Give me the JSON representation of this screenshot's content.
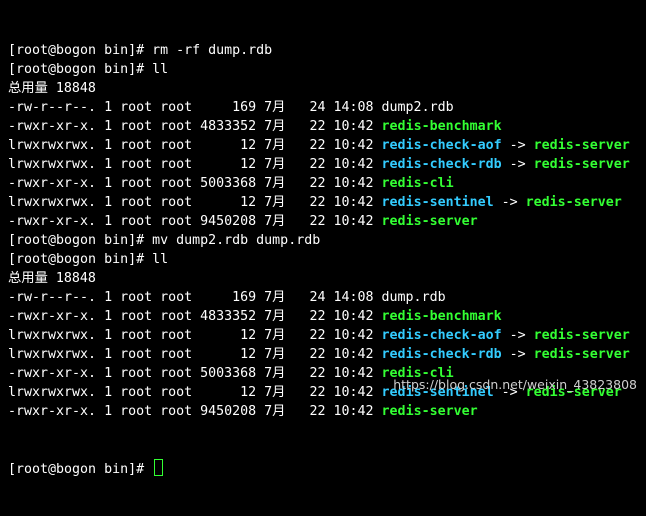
{
  "colors": {
    "background": "#000000",
    "text": "#ffffff",
    "executable": "#33ff33",
    "symlink": "#33ccff",
    "cursor": "#33ff33"
  },
  "terminal": {
    "lines": [
      {
        "segments": [
          {
            "text": "[root@bogon bin]# rm -rf dump.rdb",
            "color": "white"
          }
        ]
      },
      {
        "segments": [
          {
            "text": "[root@bogon bin]# ll",
            "color": "white"
          }
        ]
      },
      {
        "segments": [
          {
            "text": "总用量 18848",
            "color": "white"
          }
        ]
      },
      {
        "segments": [
          {
            "text": "-rw-r--r--. 1 root root     169 7月   24 14:08 dump2.rdb",
            "color": "white"
          }
        ]
      },
      {
        "segments": [
          {
            "text": "-rwxr-xr-x. 1 root root 4833352 7月   22 10:42 ",
            "color": "white"
          },
          {
            "text": "redis-benchmark",
            "color": "green"
          }
        ]
      },
      {
        "segments": [
          {
            "text": "lrwxrwxrwx. 1 root root      12 7月   22 10:42 ",
            "color": "white"
          },
          {
            "text": "redis-check-aof",
            "color": "cyan"
          },
          {
            "text": " -> ",
            "color": "white"
          },
          {
            "text": "redis-server",
            "color": "green"
          }
        ]
      },
      {
        "segments": [
          {
            "text": "lrwxrwxrwx. 1 root root      12 7月   22 10:42 ",
            "color": "white"
          },
          {
            "text": "redis-check-rdb",
            "color": "cyan"
          },
          {
            "text": " -> ",
            "color": "white"
          },
          {
            "text": "redis-server",
            "color": "green"
          }
        ]
      },
      {
        "segments": [
          {
            "text": "-rwxr-xr-x. 1 root root 5003368 7月   22 10:42 ",
            "color": "white"
          },
          {
            "text": "redis-cli",
            "color": "green"
          }
        ]
      },
      {
        "segments": [
          {
            "text": "lrwxrwxrwx. 1 root root      12 7月   22 10:42 ",
            "color": "white"
          },
          {
            "text": "redis-sentinel",
            "color": "cyan"
          },
          {
            "text": " -> ",
            "color": "white"
          },
          {
            "text": "redis-server",
            "color": "green"
          }
        ]
      },
      {
        "segments": [
          {
            "text": "-rwxr-xr-x. 1 root root 9450208 7月   22 10:42 ",
            "color": "white"
          },
          {
            "text": "redis-server",
            "color": "green"
          }
        ]
      },
      {
        "segments": [
          {
            "text": "[root@bogon bin]# mv dump2.rdb dump.rdb",
            "color": "white"
          }
        ]
      },
      {
        "segments": [
          {
            "text": "[root@bogon bin]# ll",
            "color": "white"
          }
        ]
      },
      {
        "segments": [
          {
            "text": "总用量 18848",
            "color": "white"
          }
        ]
      },
      {
        "segments": [
          {
            "text": "-rw-r--r--. 1 root root     169 7月   24 14:08 dump.rdb",
            "color": "white"
          }
        ]
      },
      {
        "segments": [
          {
            "text": "-rwxr-xr-x. 1 root root 4833352 7月   22 10:42 ",
            "color": "white"
          },
          {
            "text": "redis-benchmark",
            "color": "green"
          }
        ]
      },
      {
        "segments": [
          {
            "text": "lrwxrwxrwx. 1 root root      12 7月   22 10:42 ",
            "color": "white"
          },
          {
            "text": "redis-check-aof",
            "color": "cyan"
          },
          {
            "text": " -> ",
            "color": "white"
          },
          {
            "text": "redis-server",
            "color": "green"
          }
        ]
      },
      {
        "segments": [
          {
            "text": "lrwxrwxrwx. 1 root root      12 7月   22 10:42 ",
            "color": "white"
          },
          {
            "text": "redis-check-rdb",
            "color": "cyan"
          },
          {
            "text": " -> ",
            "color": "white"
          },
          {
            "text": "redis-server",
            "color": "green"
          }
        ]
      },
      {
        "segments": [
          {
            "text": "-rwxr-xr-x. 1 root root 5003368 7月   22 10:42 ",
            "color": "white"
          },
          {
            "text": "redis-cli",
            "color": "green"
          }
        ]
      },
      {
        "segments": [
          {
            "text": "lrwxrwxrwx. 1 root root      12 7月   22 10:42 ",
            "color": "white"
          },
          {
            "text": "redis-sentinel",
            "color": "cyan"
          },
          {
            "text": " -> ",
            "color": "white"
          },
          {
            "text": "redis-server",
            "color": "green"
          }
        ]
      },
      {
        "segments": [
          {
            "text": "-rwxr-xr-x. 1 root root 9450208 7月   22 10:42 ",
            "color": "white"
          },
          {
            "text": "redis-server",
            "color": "green"
          }
        ]
      }
    ],
    "prompt": "[root@bogon bin]# "
  },
  "watermark": "https://blog.csdn.net/weixin_43823808"
}
